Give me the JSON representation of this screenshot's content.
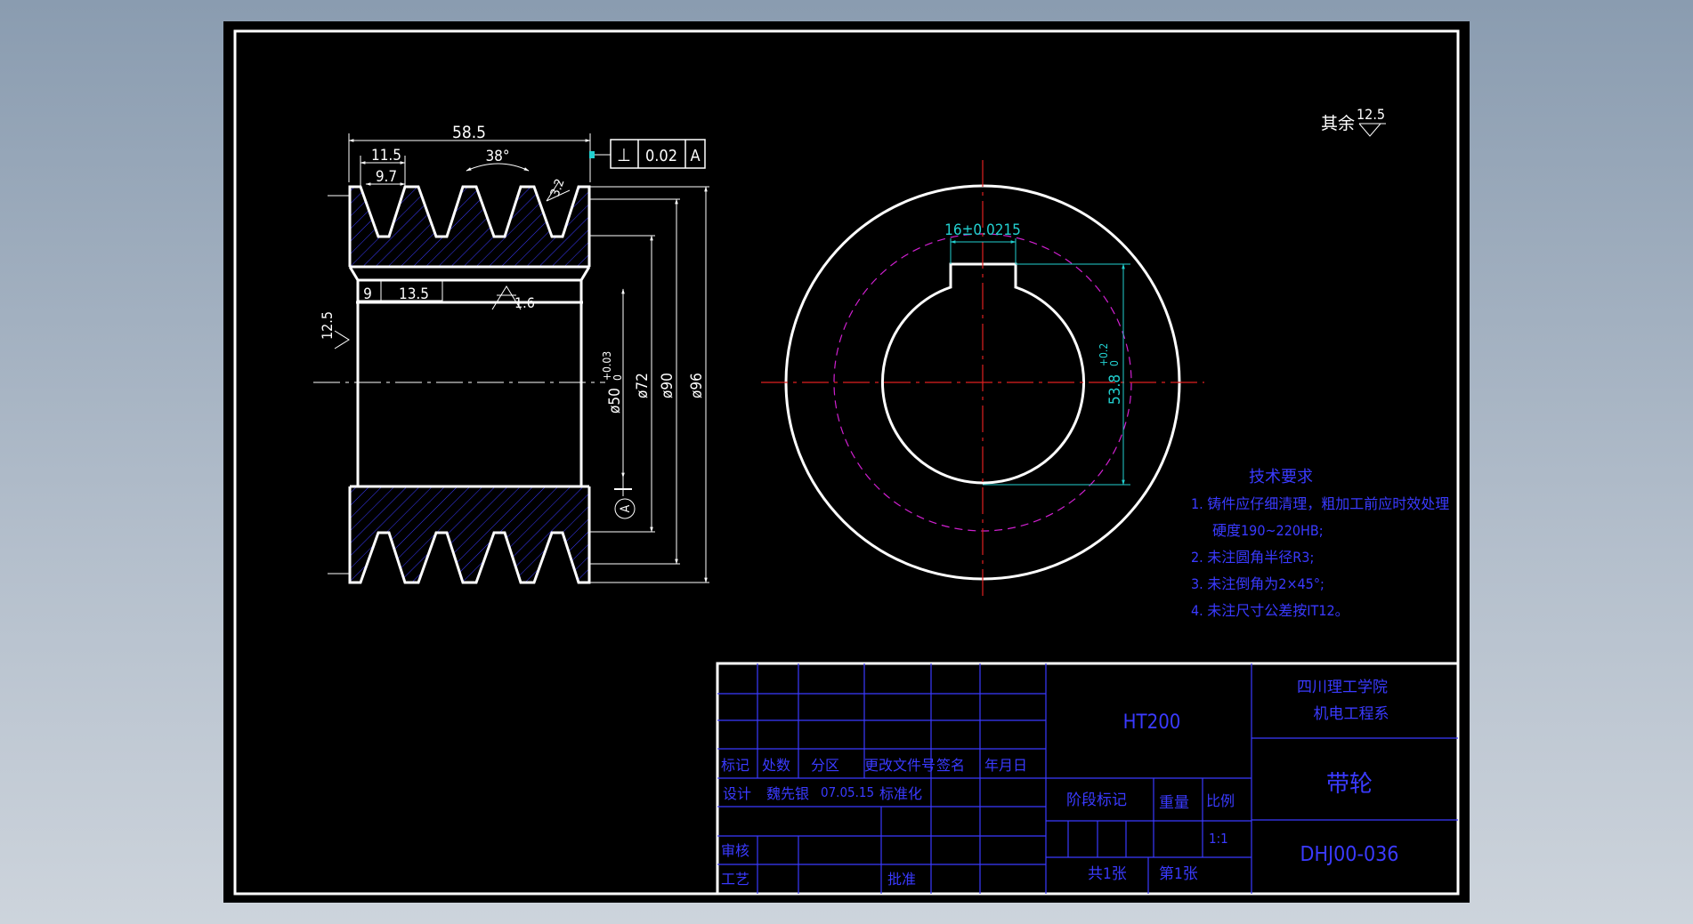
{
  "surface_finish_note": {
    "label": "其余",
    "value": "12.5"
  },
  "dimensions": {
    "overall_width": "58.5",
    "groove_pitch_outer": "11.5",
    "groove_pitch_inner": "9.7",
    "groove_angle": "38°",
    "groove_roughness": "3.2",
    "hub_offset": "9",
    "hub_width": "13.5",
    "bore_roughness": "1.6",
    "side_roughness": "12.5",
    "bore_dia": "ø50",
    "bore_tol_upper": "+0.03",
    "bore_tol_lower": "0",
    "dia_72": "ø72",
    "dia_90": "ø90",
    "dia_96": "ø96",
    "key_width": "16±0.0215",
    "key_depth": "53.8",
    "key_depth_tol_upper": "+0.2",
    "key_depth_tol_lower": "0",
    "datum_label": "A"
  },
  "tolerance_frame": {
    "symbol": "⊥",
    "value": "0.02",
    "datum": "A"
  },
  "tech_requirements": {
    "title": "技术要求",
    "lines": [
      "1. 铸件应仔细清理，粗加工前应时效处理",
      "硬度190~220HB;",
      "2. 未注圆角半径R3;",
      "3. 未注倒角为2×45°;",
      "4. 未注尺寸公差按IT12。"
    ]
  },
  "title_block": {
    "material": "HT200",
    "school": "四川理工学院",
    "department": "机电工程系",
    "part_name": "带轮",
    "drawing_no": "DHJ00-036",
    "headers": [
      "标记",
      "处数",
      "分区",
      "更改文件号",
      "签名",
      "年月日"
    ],
    "design_label": "设计",
    "designer": "魏先银",
    "design_date": "07.05.15",
    "standardize": "标准化",
    "review": "审核",
    "process": "工艺",
    "approve": "批准",
    "stage_mark": "阶段标记",
    "weight": "重量",
    "scale_label": "比例",
    "scale": "1:1",
    "sheet_total": "共1张",
    "sheet_no": "第1张"
  }
}
